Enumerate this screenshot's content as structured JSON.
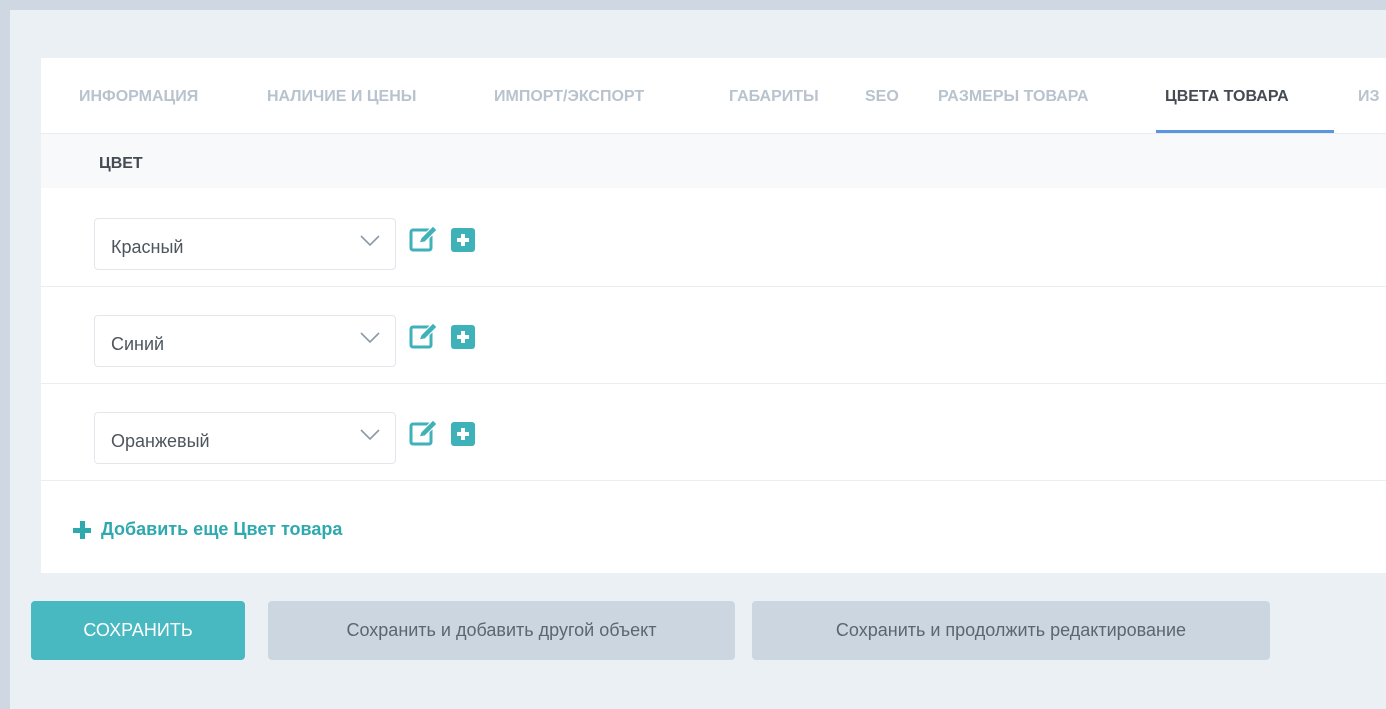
{
  "tabs": [
    {
      "label": "ИНФОРМАЦИЯ"
    },
    {
      "label": "НАЛИЧИЕ И ЦЕНЫ"
    },
    {
      "label": "ИМПОРТ/ЭКСПОРТ"
    },
    {
      "label": "ГАБАРИТЫ"
    },
    {
      "label": "SEO"
    },
    {
      "label": "РАЗМЕРЫ ТОВАРА"
    },
    {
      "label": "ЦВЕТА ТОВАРА"
    },
    {
      "label": "ИЗ"
    }
  ],
  "active_tab": "ЦВЕТА ТОВАРА",
  "section": {
    "title": "ЦВЕТ"
  },
  "colors": [
    {
      "value": "Красный"
    },
    {
      "value": "Синий"
    },
    {
      "value": "Оранжевый"
    }
  ],
  "add_more": {
    "label": "Добавить еще Цвет товара"
  },
  "buttons": {
    "save": "СОХРАНИТЬ",
    "save_add_another": "Сохранить и добавить другой объект",
    "save_continue": "Сохранить и продолжить редактирование"
  },
  "theme": {
    "accent": "#49b9c1",
    "link": "#2ea9ae",
    "active_tab_underline": "#5b95e0",
    "secondary_button": "#ccd6e0"
  },
  "icons": [
    "chevron-down-icon",
    "edit-icon",
    "add-icon",
    "plus-icon"
  ]
}
